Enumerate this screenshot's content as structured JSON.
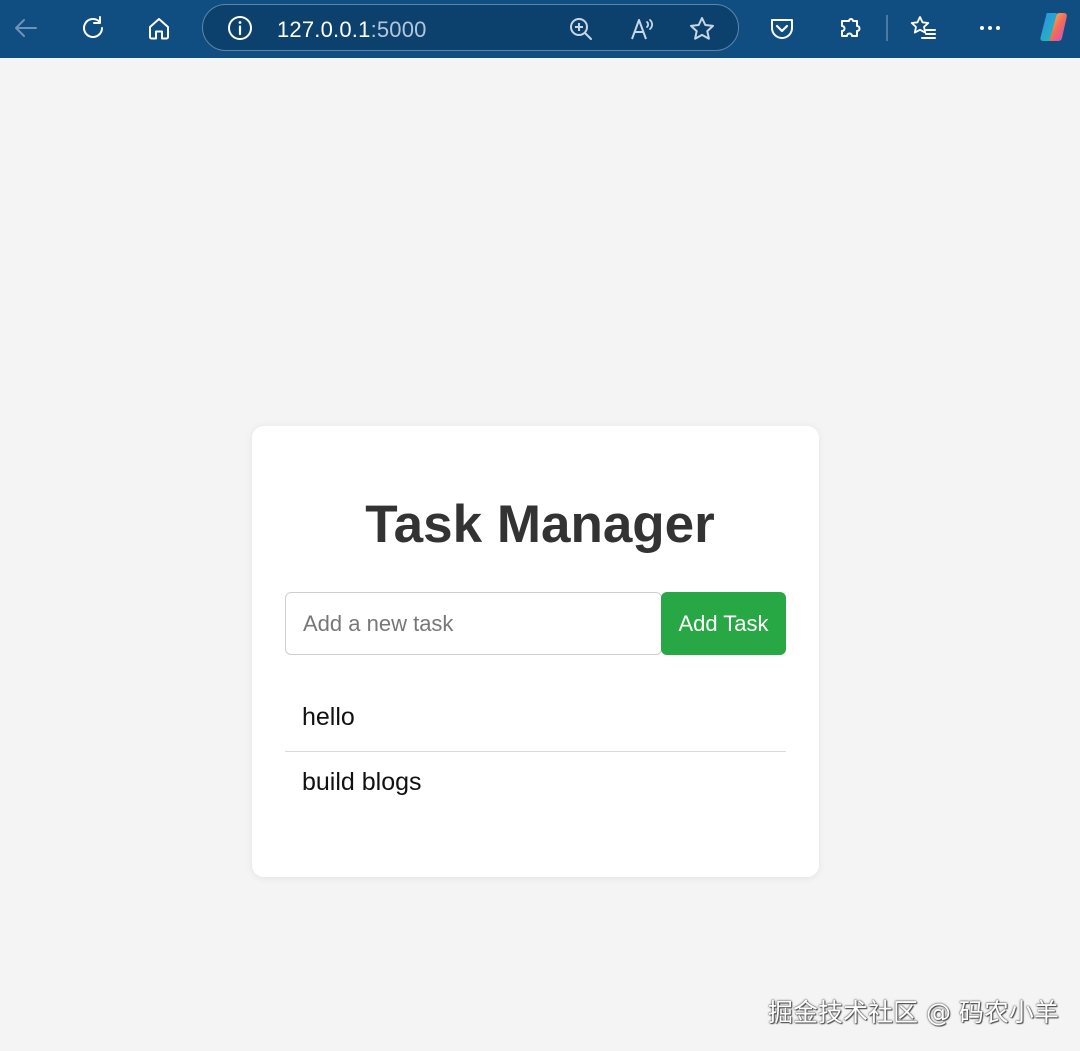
{
  "browser": {
    "url_host": "127.0.0.1",
    "url_port": ":5000",
    "toolbar_icons": [
      "back-icon",
      "refresh-icon",
      "home-icon",
      "info-icon",
      "zoom-icon",
      "read-aloud-icon",
      "favorite-star-icon",
      "pocket-icon",
      "extensions-icon",
      "favorites-list-icon",
      "more-icon",
      "copilot-icon"
    ],
    "toolbar_color": "#104d80"
  },
  "app": {
    "title": "Task Manager",
    "input_placeholder": "Add a new task",
    "add_button_label": "Add Task",
    "accent_color": "#28a745",
    "tasks": [
      {
        "label": "hello"
      },
      {
        "label": "build blogs"
      }
    ]
  },
  "watermark": "掘金技术社区 @ 码农小羊"
}
